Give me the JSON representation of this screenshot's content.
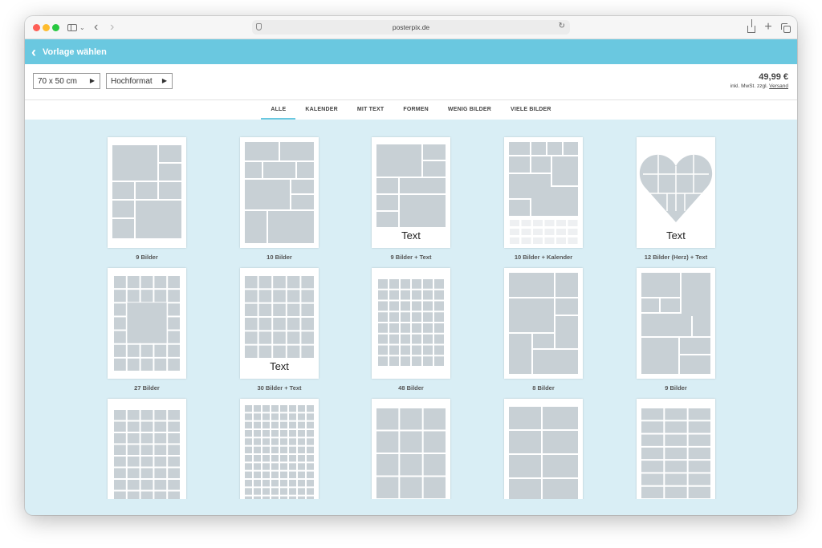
{
  "browser": {
    "url": "posterpix.de",
    "icons": [
      "sidebar-icon",
      "chevron-down-icon",
      "back-icon",
      "forward-icon",
      "reload-icon",
      "share-icon",
      "plus-icon",
      "tabs-icon"
    ]
  },
  "header": {
    "back_icon": "chevron-left-icon",
    "title": "Vorlage wählen",
    "color": "#6ac8e0"
  },
  "options": {
    "size": "70 x 50 cm",
    "orientation": "Hochformat",
    "price": "49,99 €",
    "price_note": "inkl. MwSt. zzgl.",
    "shipping_link": "Versand"
  },
  "categories": [
    {
      "label": "ALLE",
      "active": true
    },
    {
      "label": "KALENDER",
      "active": false
    },
    {
      "label": "MIT TEXT",
      "active": false
    },
    {
      "label": "FORMEN",
      "active": false
    },
    {
      "label": "WENIG BILDER",
      "active": false
    },
    {
      "label": "VIELE BILDER",
      "active": false
    }
  ],
  "templates": [
    {
      "label": "9 Bilder",
      "text": ""
    },
    {
      "label": "10 Bilder",
      "text": ""
    },
    {
      "label": "9 Bilder + Text",
      "text": "Text"
    },
    {
      "label": "10 Bilder + Kalender",
      "text": ""
    },
    {
      "label": "12 Bilder (Herz) + Text",
      "text": "Text"
    },
    {
      "label": "27 Bilder",
      "text": ""
    },
    {
      "label": "30 Bilder + Text",
      "text": "Text"
    },
    {
      "label": "48 Bilder",
      "text": ""
    },
    {
      "label": "8 Bilder",
      "text": ""
    },
    {
      "label": "9 Bilder",
      "text": ""
    },
    {
      "label": "",
      "text": ""
    },
    {
      "label": "",
      "text": ""
    },
    {
      "label": "",
      "text": ""
    },
    {
      "label": "",
      "text": ""
    },
    {
      "label": "",
      "text": ""
    }
  ],
  "colors": {
    "placeholder": "#c8d0d5",
    "background": "#d9eef5",
    "accent": "#6ac8e0"
  }
}
